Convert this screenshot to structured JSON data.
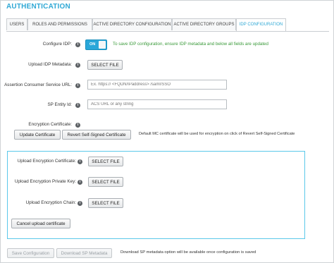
{
  "page": {
    "title": "AUTHENTICATION"
  },
  "tabs": [
    {
      "label": "USERS"
    },
    {
      "label": "ROLES AND PERMISSIONS"
    },
    {
      "label": "ACTIVE DIRECTORY CONFIGURATION"
    },
    {
      "label": "ACTIVE DIRECTORY GROUPS"
    },
    {
      "label": "IDP CONFIGURATION",
      "active": true
    }
  ],
  "help_glyph": "i",
  "form": {
    "configure_idp": {
      "label": "Configure IDP:",
      "toggle_label": "ON",
      "enabled": true,
      "note": "To save IDP configuration, ensure IDP metadata and below all fields are updated"
    },
    "upload_idp_metadata": {
      "label": "Upload IDP Metadata:",
      "button": "SELECT FILE"
    },
    "acs_url": {
      "label": "Assertion Consumer Service URL:",
      "value": "",
      "placeholder": "Ex. https:// <FQDN/IPaddress> /saml/SSO"
    },
    "sp_entity_id": {
      "label": "SP Entity Id:",
      "value": "",
      "placeholder": "ACS URL or any string"
    },
    "encryption_certificate": {
      "label": "Encryption Certificate:",
      "update_button": "Update Certificate",
      "revert_button": "Revert Self-Signed Certificate",
      "note": "Default MC certificate will be used for encryption on click of Revert Self-Signed Certificate"
    }
  },
  "upload_panel": {
    "cert_label": "Upload Encryption Certificate:",
    "key_label": "Upload Encryption Private Key:",
    "chain_label": "Upload Encryption Chain:",
    "select_button": "SELECT FILE",
    "cancel_button": "Cancel upload certificate"
  },
  "footer": {
    "save_button": "Save Configuration",
    "download_button": "Download SP Metadata",
    "note": "Download SP metadata option will be available once configuration is saved"
  },
  "colors": {
    "accent": "#2fa8d5",
    "note_green": "#3a9a3a",
    "panel_border": "#5bc8ea"
  }
}
